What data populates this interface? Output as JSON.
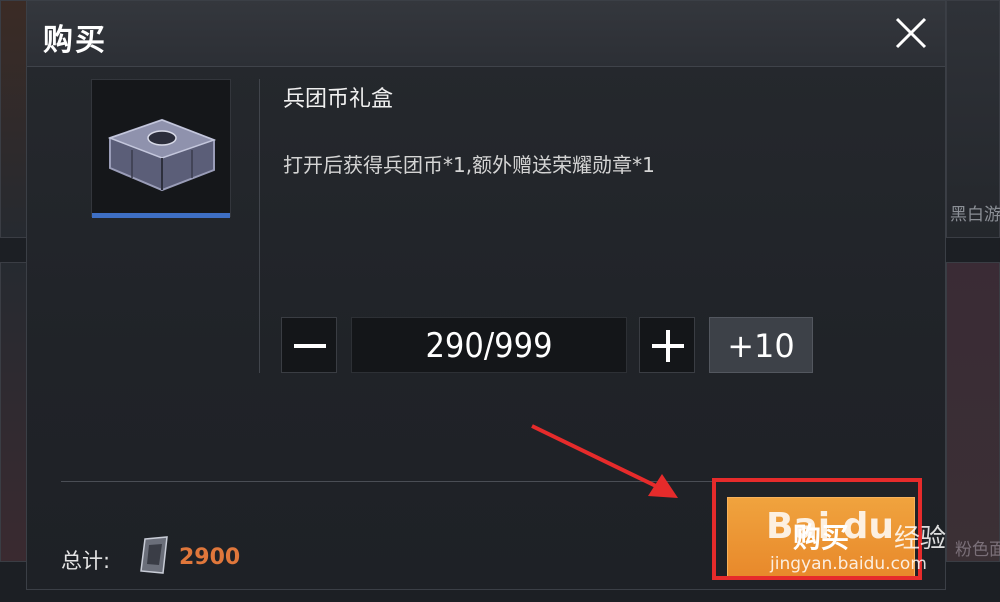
{
  "dialog": {
    "title": "购买",
    "item": {
      "name": "兵团币礼盒",
      "description": "打开后获得兵团币*1,额外赠送荣耀勋章*1"
    },
    "quantity": {
      "value": "290/999",
      "plus10_label": "+10"
    },
    "total": {
      "label": "总计:",
      "value": "2900"
    },
    "buy_button_label": "购买"
  },
  "background": {
    "right_text_1": "黑白游",
    "right_text_2": "粉色面"
  },
  "watermark": {
    "logo": "Bai du",
    "brand": "经验",
    "url": "jingyan.baidu.com"
  },
  "colors": {
    "accent_orange": "#ec9534",
    "price_orange": "#e0773b",
    "highlight_red": "#e62b2b",
    "rarity_blue": "#3e6fc4"
  }
}
